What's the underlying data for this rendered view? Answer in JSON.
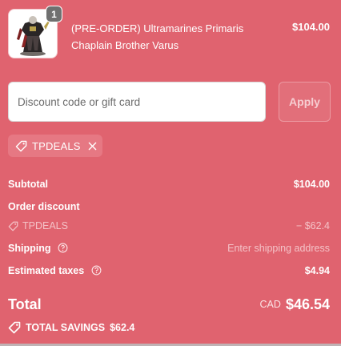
{
  "product": {
    "quantity": "1",
    "name": "(PRE-ORDER) Ultramarines Primaris Chaplain Brother Varus",
    "price": "$104.00",
    "image_icon": "miniature-figure-icon"
  },
  "discount": {
    "placeholder": "Discount code or gift card",
    "apply_label": "Apply"
  },
  "applied_code": {
    "code": "TPDEALS",
    "icon": "tag-icon",
    "remove_icon": "close-icon"
  },
  "summary": {
    "subtotal_label": "Subtotal",
    "subtotal_value": "$104.00",
    "order_discount_label": "Order discount",
    "discount_code": "TPDEALS",
    "discount_value": "− $62.4",
    "shipping_label": "Shipping",
    "shipping_value": "Enter shipping address",
    "taxes_label": "Estimated taxes",
    "taxes_value": "$4.94",
    "total_label": "Total",
    "currency": "CAD",
    "total_value": "$46.54",
    "savings_label": "TOTAL SAVINGS",
    "savings_value": "$62.4"
  },
  "colors": {
    "background": "#e0636f",
    "chip": "#e67883",
    "muted_text": "#f4c2c7"
  }
}
